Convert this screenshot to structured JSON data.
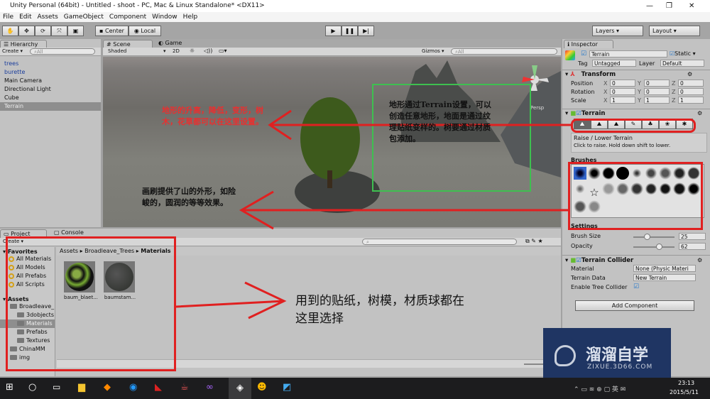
{
  "window": {
    "title": "Unity Personal (64bit) - Untitled - shoot - PC, Mac & Linux Standalone* <DX11>"
  },
  "menu": [
    "File",
    "Edit",
    "Assets",
    "GameObject",
    "Component",
    "Window",
    "Help"
  ],
  "toolbar": {
    "center": "Center",
    "local": "Local",
    "layers": "Layers",
    "layout": "Layout"
  },
  "hierarchy": {
    "tab": "Hierarchy",
    "create": "Create",
    "search": "All",
    "items": [
      {
        "label": "trees",
        "style": "blue"
      },
      {
        "label": "burette",
        "style": "blue"
      },
      {
        "label": "Main Camera",
        "style": ""
      },
      {
        "label": "Directional Light",
        "style": ""
      },
      {
        "label": "Cube",
        "style": ""
      },
      {
        "label": "Terrain",
        "style": "sel"
      }
    ]
  },
  "scene": {
    "tab_scene": "Scene",
    "tab_game": "Game",
    "shading": "Shaded",
    "mode2d": "2D",
    "gizmos": "Gizmos",
    "search": "All",
    "persp": "Persp"
  },
  "inspector": {
    "tab": "Inspector",
    "name": "Terrain",
    "static": "Static",
    "tag_label": "Tag",
    "tag": "Untagged",
    "layer_label": "Layer",
    "layer": "Default",
    "transform": {
      "title": "Transform",
      "rows": [
        {
          "label": "Position",
          "x": "0",
          "y": "0",
          "z": "0"
        },
        {
          "label": "Rotation",
          "x": "0",
          "y": "0",
          "z": "0"
        },
        {
          "label": "Scale",
          "x": "1",
          "y": "1",
          "z": "1"
        }
      ]
    },
    "terrain": {
      "title": "Terrain",
      "tool_title": "Raise / Lower Terrain",
      "tool_help": "Click to raise. Hold down shift to lower.",
      "brushes": "Brushes",
      "settings": "Settings",
      "brush_size_label": "Brush Size",
      "brush_size": "25",
      "opacity_label": "Opacity",
      "opacity": "62",
      "brush_size_fraction": 0.25,
      "opacity_fraction": 0.62
    },
    "collider": {
      "title": "Terrain Collider",
      "material_label": "Material",
      "material": "None (Physic Materi",
      "data_label": "Terrain Data",
      "data": "New Terrain",
      "tree_label": "Enable Tree Collider"
    },
    "add_component": "Add Component"
  },
  "project": {
    "tab_project": "Project",
    "tab_console": "Console",
    "create": "Create",
    "favorites": "Favorites",
    "fav_items": [
      "All Materials",
      "All Models",
      "All Prefabs",
      "All Scripts"
    ],
    "assets": "Assets",
    "tree": [
      {
        "label": "Broadleave_",
        "indent": 1
      },
      {
        "label": "3dobjects",
        "indent": 2
      },
      {
        "label": "Materials",
        "indent": 2
      },
      {
        "label": "Prefabs",
        "indent": 2
      },
      {
        "label": "Textures",
        "indent": 2
      },
      {
        "label": "ChinaMM",
        "indent": 1
      },
      {
        "label": "img",
        "indent": 1
      }
    ],
    "breadcrumb": [
      "Assets",
      "Broadleave_Trees",
      "Materials"
    ],
    "files": [
      "baum_blaet...",
      "baumstam..."
    ]
  },
  "annotations": {
    "red": "地形的升高，降低，变形，树木，花草都可以在这里设置。",
    "terrain_note": "地形通过Terrain设置，可以创造任意地形，地面是通过纹理贴纸变样的。树要通过材质包添加。",
    "brush_note": "画刷提供了山的外形，如险峻的，圆润的等等效果。",
    "project_note": "用到的贴纸，树模，材质球都在这里选择"
  },
  "watermark": {
    "name": "溜溜自学",
    "url": "ZIXUE.3D66.COM"
  },
  "taskbar": {
    "time": "23:13",
    "date": "2015/5/11"
  }
}
